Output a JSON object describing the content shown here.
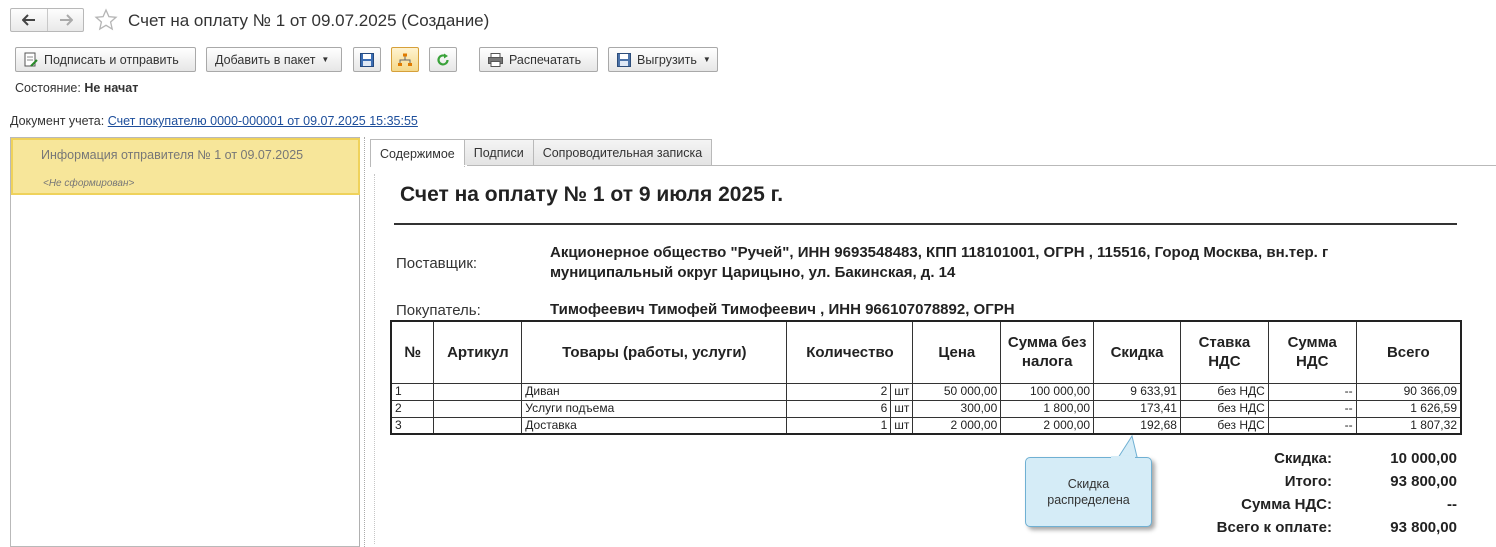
{
  "window": {
    "title": "Счет на оплату № 1 от 09.07.2025 (Создание)"
  },
  "toolbar": {
    "sign_send": "Подписать и отправить",
    "add_package": "Добавить в пакет",
    "print": "Распечатать",
    "export": "Выгрузить"
  },
  "status": {
    "label": "Состояние:",
    "value": "Не начат"
  },
  "accounting_doc": {
    "label": "Документ учета:",
    "link": "Счет покупателю 0000-000001 от 09.07.2025 15:35:55"
  },
  "left_list": {
    "item_title": "Информация отправителя № 1 от 09.07.2025",
    "item_status": "<Не сформирован>"
  },
  "tabs": [
    "Содержимое",
    "Подписи",
    "Сопроводительная записка"
  ],
  "document": {
    "title": "Счет на оплату № 1 от 9 июля 2025 г.",
    "supplier_label": "Поставщик:",
    "supplier_value": "Акционерное общество \"Ручей\", ИНН 9693548483, КПП 118101001, ОГРН , 115516, Город Москва, вн.тер. г муниципальный округ Царицыно, ул. Бакинская, д. 14",
    "buyer_label": "Покупатель:",
    "buyer_value": "Тимофеевич Тимофей Тимофеевич , ИНН 966107078892, ОГРН",
    "columns": [
      "№",
      "Артикул",
      "Товары (работы, услуги)",
      "Количество",
      "Цена",
      "Сумма без налога",
      "Скидка",
      "Ставка НДС",
      "Сумма НДС",
      "Всего"
    ],
    "rows": [
      {
        "n": "1",
        "article": "",
        "name": "Диван",
        "qty": "2",
        "unit": "шт",
        "price": "50 000,00",
        "sum": "100 000,00",
        "discount": "9 633,91",
        "vat_rate": "без НДС",
        "vat_sum": "--",
        "total": "90 366,09"
      },
      {
        "n": "2",
        "article": "",
        "name": "Услуги подъема",
        "qty": "6",
        "unit": "шт",
        "price": "300,00",
        "sum": "1 800,00",
        "discount": "173,41",
        "vat_rate": "без НДС",
        "vat_sum": "--",
        "total": "1 626,59"
      },
      {
        "n": "3",
        "article": "",
        "name": "Доставка",
        "qty": "1",
        "unit": "шт",
        "price": "2 000,00",
        "sum": "2 000,00",
        "discount": "192,68",
        "vat_rate": "без НДС",
        "vat_sum": "--",
        "total": "1 807,32"
      }
    ],
    "totals": [
      {
        "label": "Скидка:",
        "value": "10 000,00"
      },
      {
        "label": "Итого:",
        "value": "93 800,00"
      },
      {
        "label": "Сумма НДС:",
        "value": "--"
      },
      {
        "label": "Всего к оплате:",
        "value": "93 800,00"
      }
    ]
  },
  "callout": {
    "text": "Скидка распределена"
  },
  "colors": {
    "link": "#1d4e9b",
    "selected_item": "#f7e69a",
    "callout_bg": "#d5ecf7",
    "refresh_green": "#3aa23a"
  }
}
